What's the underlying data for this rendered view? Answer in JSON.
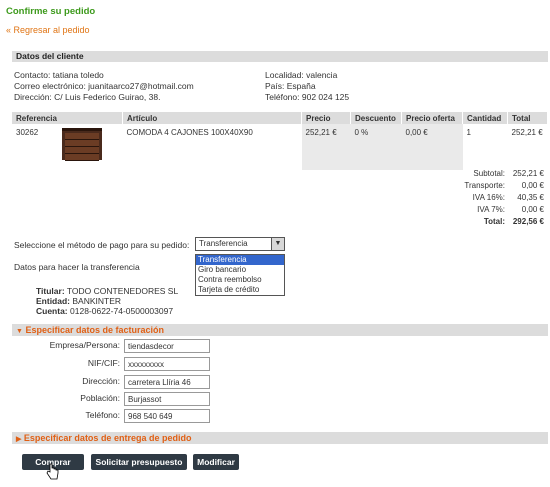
{
  "page": {
    "title": "Confirme su pedido",
    "back_link": "« Regresar al pedido"
  },
  "client": {
    "section_title": "Datos del cliente",
    "left": [
      "Contacto: tatiana toledo",
      "Correo electrónico: juanitaarco27@hotmail.com",
      "Dirección: C/ Luis Federico Guirao, 38."
    ],
    "right": [
      "Localidad: valencia",
      "País: España",
      "Teléfono: 902 024 125"
    ]
  },
  "items_table": {
    "headers": [
      "Referencia",
      "Artículo",
      "Precio",
      "Descuento",
      "Precio oferta",
      "Cantidad",
      "Total"
    ],
    "rows": [
      {
        "ref": "30262",
        "article": "COMODA 4 CAJONES 100X40X90",
        "price": "252,21 €",
        "discount": "0 %",
        "offer_price": "0,00 €",
        "quantity": "1",
        "total": "252,21 €"
      }
    ]
  },
  "totals": {
    "subtotal_label": "Subtotal:",
    "subtotal": "252,21 €",
    "transport_label": "Transporte:",
    "transport": "0,00 €",
    "iva16_label": "IVA 16%:",
    "iva16": "40,35 €",
    "iva7_label": "IVA 7%:",
    "iva7": "0,00 €",
    "total_label": "Total:",
    "total": "292,56 €"
  },
  "payment": {
    "label": "Seleccione el método de pago para su pedido:",
    "selected": "Transferencia",
    "options": [
      "Transferencia",
      "Giro bancario",
      "Contra reembolso",
      "Tarjeta de crédito"
    ],
    "transfer_label": "Datos para hacer la transferencia",
    "holder_label": "Titular:",
    "holder": "TODO CONTENEDORES SL",
    "entity_label": "Entidad:",
    "entity": "BANKINTER",
    "account_label": "Cuenta:",
    "account": "0128-0622-74-0500003097"
  },
  "billing": {
    "section_title": "Especificar datos de facturación",
    "company_label": "Empresa/Persona:",
    "company": "tiendasdecor",
    "nif_label": "NIF/CIF:",
    "nif": "xxxxxxxxx",
    "address_label": "Dirección:",
    "address": "carretera Llíria 46",
    "city_label": "Población:",
    "city": "Burjassot",
    "phone_label": "Teléfono:",
    "phone": "968 540 649"
  },
  "delivery": {
    "section_title": "Especificar datos de entrega de pedido"
  },
  "buttons": {
    "buy": "Comprar",
    "quote": "Solicitar presupuesto",
    "modify": "Modificar"
  }
}
